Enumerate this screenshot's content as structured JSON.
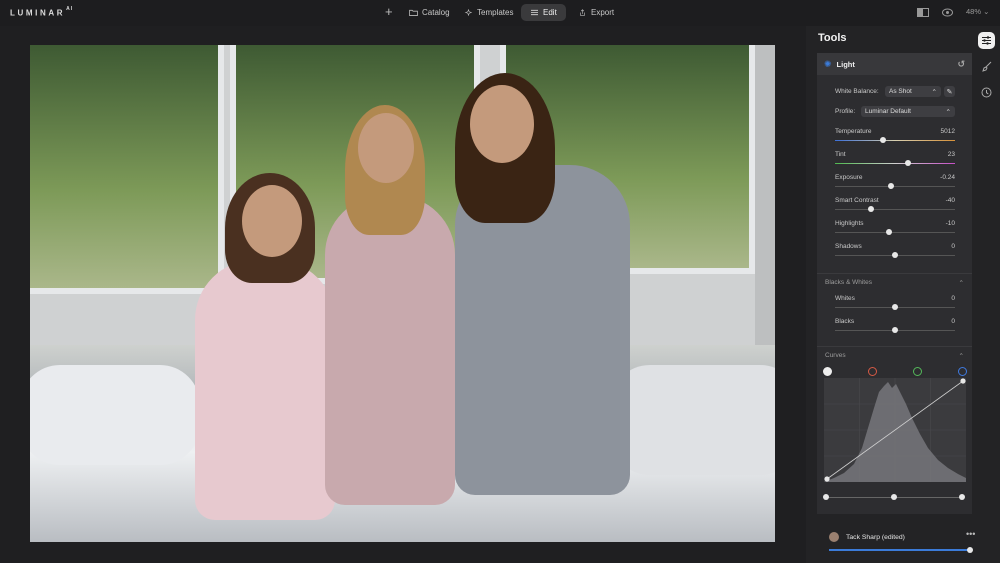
{
  "app": {
    "logo": "LUMINAR",
    "logo_suffix": "AI"
  },
  "top_nav": {
    "tabs": [
      {
        "label": "Catalog",
        "icon": "folder-icon"
      },
      {
        "label": "Templates",
        "icon": "templates-icon"
      },
      {
        "label": "Edit",
        "icon": "sliders-icon",
        "active": true
      },
      {
        "label": "Export",
        "icon": "export-icon"
      }
    ],
    "zoom": "48%"
  },
  "panel": {
    "title": "Tools",
    "light": {
      "title": "Light",
      "white_balance": {
        "label": "White Balance:",
        "value": "As Shot"
      },
      "profile": {
        "label": "Profile:",
        "value": "Luminar Default"
      },
      "sliders": [
        {
          "label": "Temperature",
          "value": "5012",
          "pos": 0.4
        },
        {
          "label": "Tint",
          "value": "23",
          "pos": 0.61
        },
        {
          "label": "Exposure",
          "value": "-0.24",
          "pos": 0.47
        },
        {
          "label": "Smart Contrast",
          "value": "-40",
          "pos": 0.3
        },
        {
          "label": "Highlights",
          "value": "-10",
          "pos": 0.45
        },
        {
          "label": "Shadows",
          "value": "0",
          "pos": 0.5
        }
      ]
    },
    "blacks_whites": {
      "title": "Blacks & Whites",
      "sliders": [
        {
          "label": "Whites",
          "value": "0",
          "pos": 0.5
        },
        {
          "label": "Blacks",
          "value": "0",
          "pos": 0.5
        }
      ]
    },
    "curves": {
      "title": "Curves",
      "channels": [
        "white",
        "red",
        "green",
        "blue"
      ]
    },
    "preset": {
      "name": "Tack Sharp (edited)",
      "amount": 1.0
    }
  },
  "colors": {
    "accent": "#3b7bd8",
    "panel_bg": "#2d2d30",
    "red": "#d65a45",
    "green": "#54b85a",
    "blue": "#3f7ae0"
  }
}
